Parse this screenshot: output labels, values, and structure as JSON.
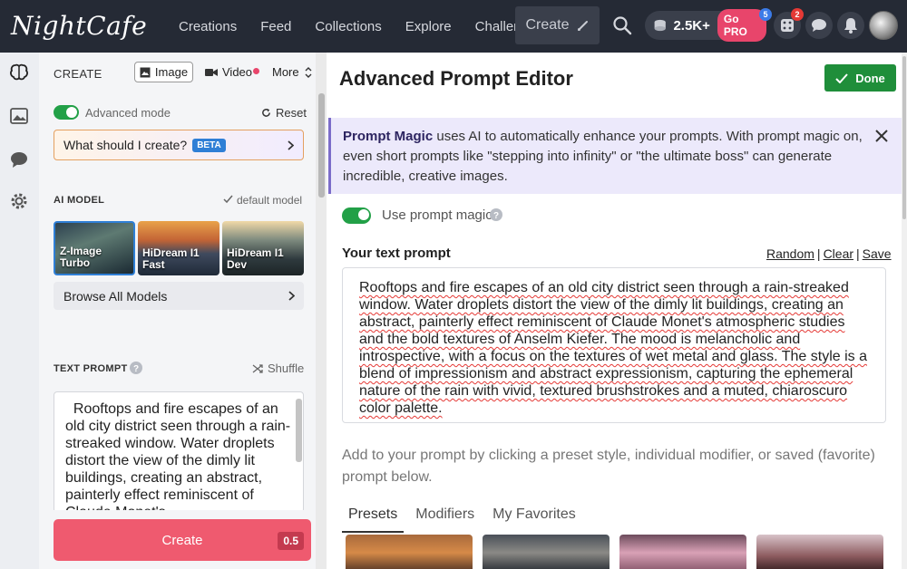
{
  "brand": {
    "logo_text": "NightCafe"
  },
  "nav": {
    "items": [
      "Creations",
      "Feed",
      "Collections",
      "Explore",
      "Challenges"
    ],
    "create_label": "Create",
    "credits": "2.5K+",
    "gopro_label": "Go PRO",
    "gopro_badge": "5",
    "dice_badge": "2"
  },
  "panel": {
    "create_label": "CREATE",
    "image_tab": "Image",
    "video_tab": "Video",
    "more_label": "More",
    "advanced_mode": "Advanced mode",
    "reset_label": "Reset",
    "what_create": "What should I create?",
    "beta": "BETA",
    "ai_model_label": "AI MODEL",
    "default_model": "default model",
    "models": [
      {
        "name": "Z-Image Turbo"
      },
      {
        "name": "HiDream I1 Fast"
      },
      {
        "name": "HiDream I1 Dev"
      }
    ],
    "browse_models": "Browse All Models",
    "text_prompt_label": "TEXT PROMPT",
    "shuffle_label": "Shuffle",
    "prompt_text": "  Rooftops and fire escapes of an old city district seen through a rain-streaked window. Water droplets distort the view of the dimly lit buildings, creating an abstract, painterly effect reminiscent of Claude Monet's",
    "create_button": "Create",
    "create_cost": "0.5"
  },
  "editor": {
    "title": "Advanced Prompt Editor",
    "done_label": "Done",
    "magic_title": "Prompt Magic",
    "magic_text": " uses AI to automatically enhance your prompts. With prompt magic on, even short prompts like \"stepping into infinity\" or \"the ultimate boss\" can generate incredible, creative images.",
    "use_magic": "Use prompt magic",
    "your_prompt": "Your text prompt",
    "random": "Random",
    "clear": "Clear",
    "save": "Save",
    "separator": "|",
    "prompt_full": " Rooftops and fire escapes of an old city district seen through a rain-streaked window. Water droplets distort the view of the dimly lit buildings, creating an abstract, painterly effect reminiscent of Claude Monet's atmospheric studies and the bold textures of Anselm Kiefer. The mood is melancholic and introspective, with a focus on the textures of wet metal and glass. The style is a blend of impressionism and abstract expressionism, capturing the ephemeral nature of the rain with vivid, textured brushstrokes and a muted, chiaroscuro color palette.",
    "add_hint": "Add to your prompt by clicking a preset style, individual modifier, or saved (favorite) prompt below.",
    "tabs": [
      "Presets",
      "Modifiers",
      "My Favorites"
    ]
  },
  "colors": {
    "accent_green": "#22a047",
    "create_pink": "#ef5a6f",
    "magic_bg": "#ece9fb",
    "nav_bg": "#252a35"
  }
}
